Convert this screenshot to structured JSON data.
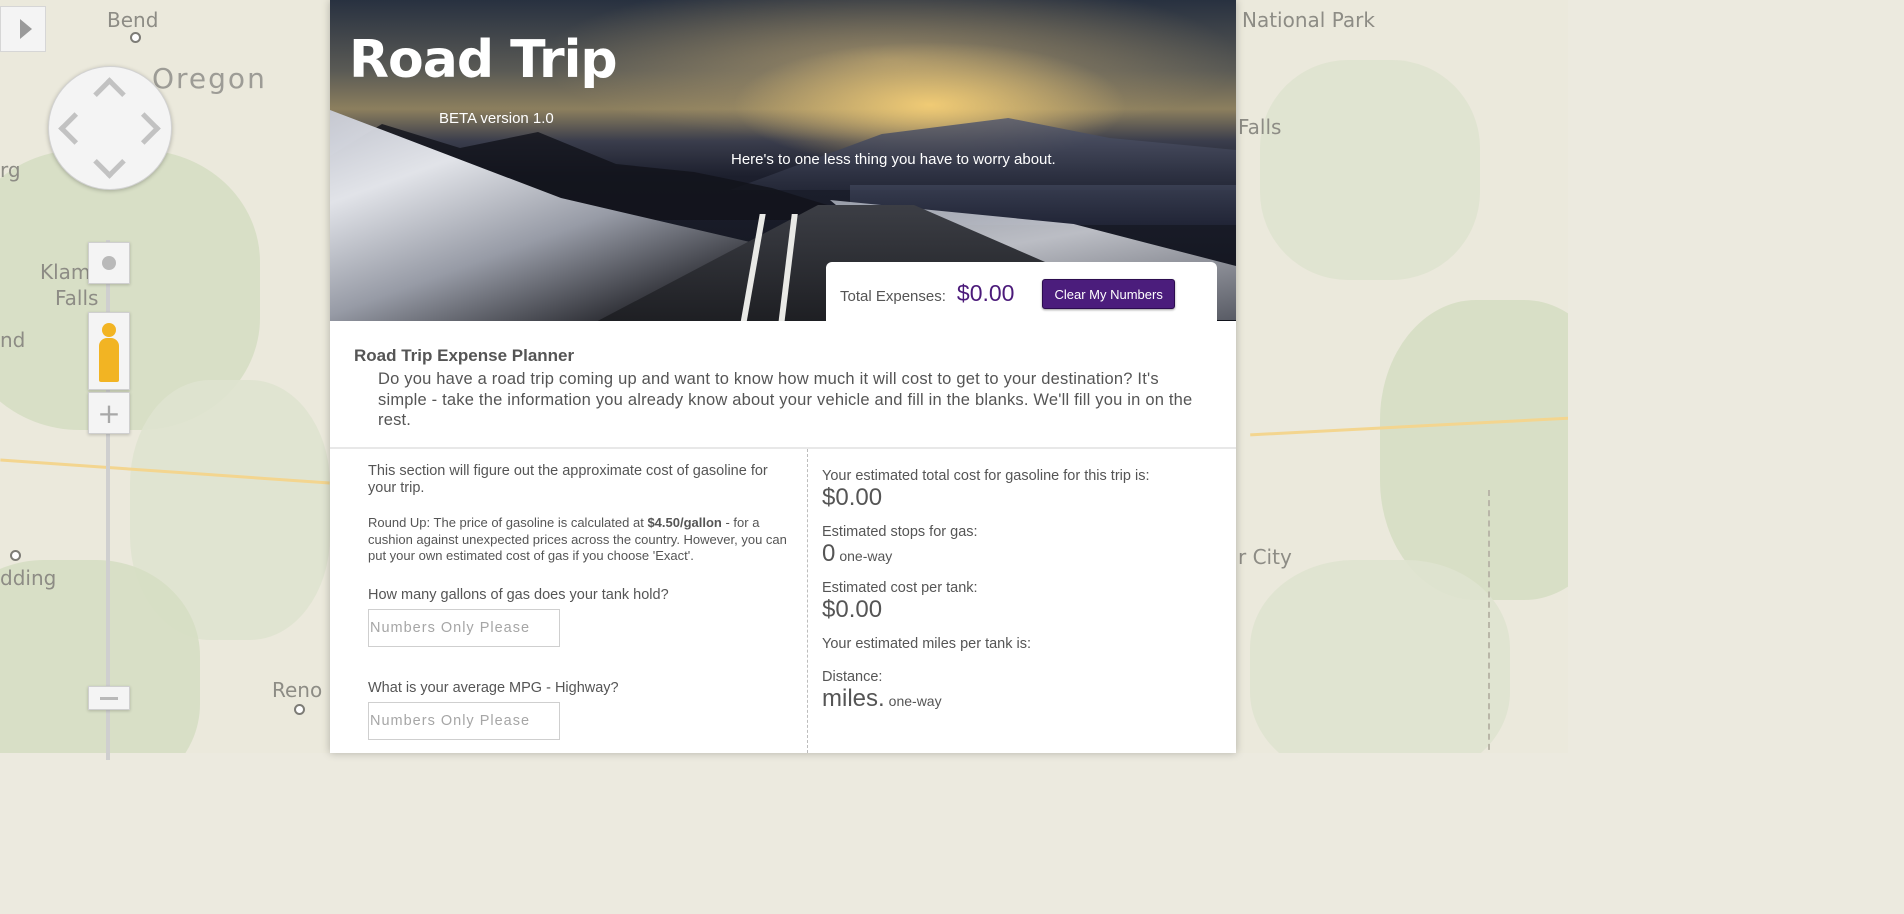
{
  "map": {
    "labels": [
      "Bend",
      "Oregon",
      "rg",
      "Klam",
      "Falls",
      "nd",
      "dding",
      "Reno",
      "National Park",
      "Falls",
      "r City"
    ]
  },
  "header": {
    "title": "Road Trip",
    "beta": "BETA version 1.0",
    "tagline": "Here's to one less thing you have to worry about."
  },
  "expenses": {
    "label": "Total Expenses:",
    "value": "$0.00",
    "clear_button": "Clear My Numbers"
  },
  "intro": {
    "heading": "Road Trip Expense Planner",
    "text": "Do you have a road trip coming up and want to know how much it will cost to get to your destination? It's simple - take the information you already know about your vehicle and fill in the blanks. We'll fill you in on the rest."
  },
  "gas_section": {
    "description": "This section will figure out the approximate cost of gasoline for your trip.",
    "roundup_prefix": "Round Up: The price of gasoline is calculated at ",
    "roundup_price": "$4.50/gallon",
    "roundup_suffix": " - for a cushion against unexpected prices across the country. However, you can put your own estimated cost of gas if you choose 'Exact'.",
    "tank_question": "How many gallons of gas does your tank hold?",
    "tank_placeholder": "Numbers Only Please",
    "mpg_question": "What is your average MPG - Highway?",
    "mpg_placeholder": "Numbers Only Please"
  },
  "results": {
    "total_gas_label": "Your estimated total cost for gasoline for this trip is:",
    "total_gas_value": "$0.00",
    "stops_label": "Estimated stops for gas:",
    "stops_value": "0",
    "stops_unit": "one-way",
    "cost_per_tank_label": "Estimated cost per tank:",
    "cost_per_tank_value": "$0.00",
    "miles_per_tank_label": "Your estimated miles per tank is:",
    "distance_label": "Distance:",
    "distance_value": "miles.",
    "distance_unit": "one-way"
  },
  "colors": {
    "accent": "#4b1d7c",
    "total_value": "#4b1a7a"
  }
}
